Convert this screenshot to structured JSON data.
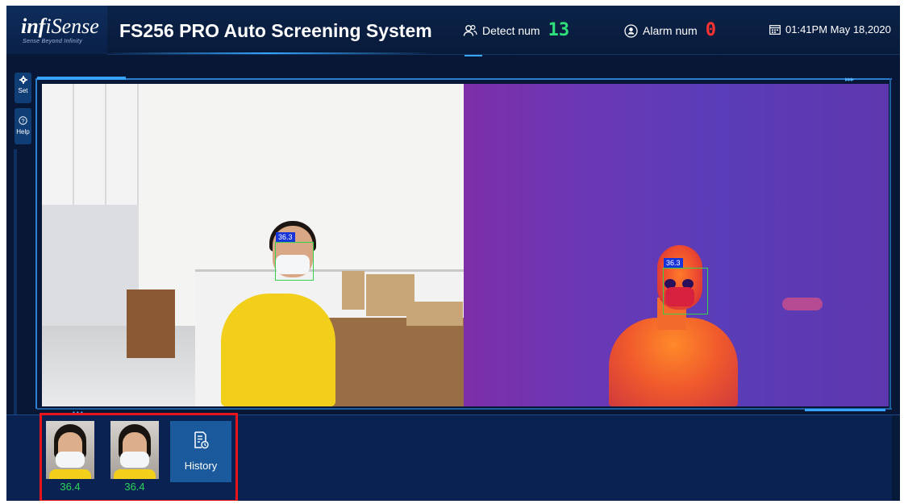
{
  "header": {
    "logo_main_1": "inf",
    "logo_main_2": "iSense",
    "logo_tag": "Sense Beyond Infinity",
    "title": "FS256 PRO Auto Screening System",
    "detect_label": "Detect num",
    "detect_value": "13",
    "alarm_label": "Alarm num",
    "alarm_value": "0",
    "datetime": "01:41PM May 18,2020"
  },
  "sidebar": {
    "set_label": "Set",
    "help_label": "Help"
  },
  "cameras": {
    "visible_temp": "36.3",
    "thermal_temp": "36.3"
  },
  "records": [
    {
      "temperature": "36.4"
    },
    {
      "temperature": "36.4"
    }
  ],
  "history_label": "History",
  "colors": {
    "background": "#071735",
    "accent": "#36a4ff",
    "detect_digits": "#2fe07a",
    "alarm_digits": "#ff3232",
    "temp_text": "#2fd35a",
    "highlight_border": "#e8141b"
  }
}
